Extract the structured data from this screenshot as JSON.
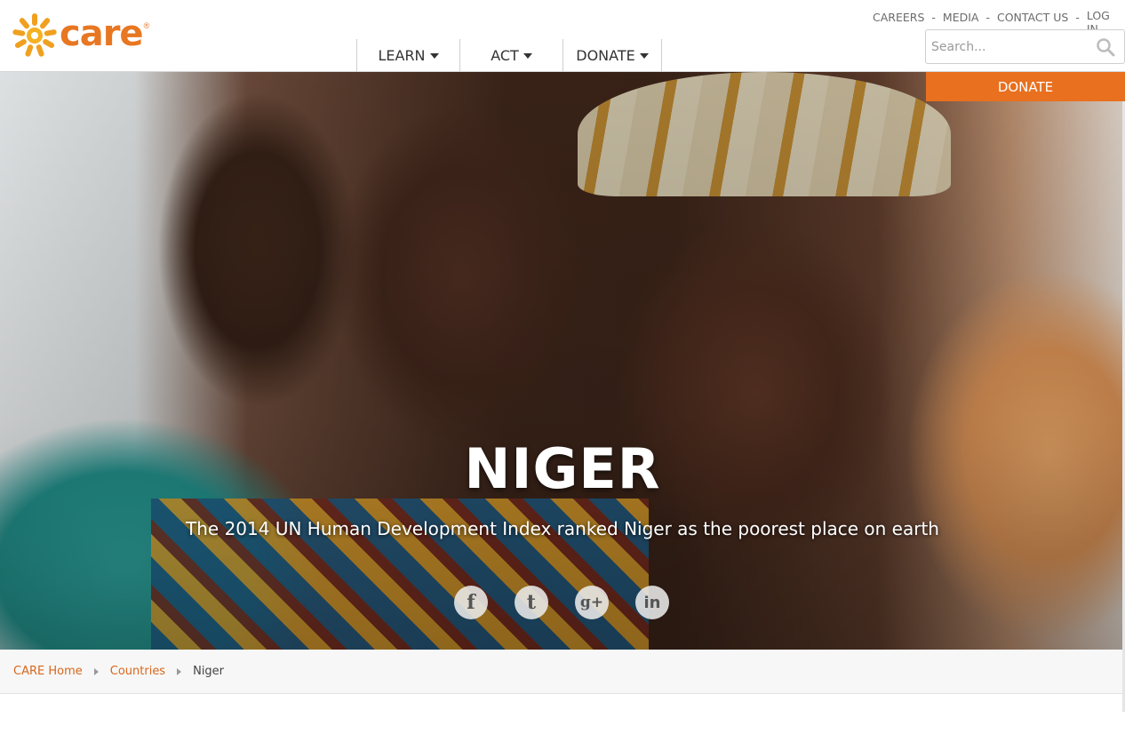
{
  "brand": {
    "logo_text": "care",
    "logo_reg": "®",
    "accent": "#e8701f"
  },
  "main_nav": [
    {
      "label": "LEARN"
    },
    {
      "label": "ACT"
    },
    {
      "label": "DONATE"
    }
  ],
  "util_nav": {
    "careers": "CAREERS",
    "media": "MEDIA",
    "contact": "CONTACT US",
    "login": "LOG IN",
    "separator": "-"
  },
  "search": {
    "placeholder": "Search..."
  },
  "donate_button": "DONATE",
  "hero": {
    "title": "NIGER",
    "subtitle": "The 2014 UN Human Development Index ranked Niger as the poorest place on earth",
    "social": [
      {
        "icon": "facebook-icon",
        "glyph": "f"
      },
      {
        "icon": "twitter-icon",
        "glyph": "t"
      },
      {
        "icon": "google-plus-icon",
        "glyph": "g+"
      },
      {
        "icon": "linkedin-icon",
        "glyph": "in"
      }
    ]
  },
  "breadcrumb": {
    "items": [
      "CARE Home",
      "Countries"
    ],
    "current": "Niger"
  }
}
